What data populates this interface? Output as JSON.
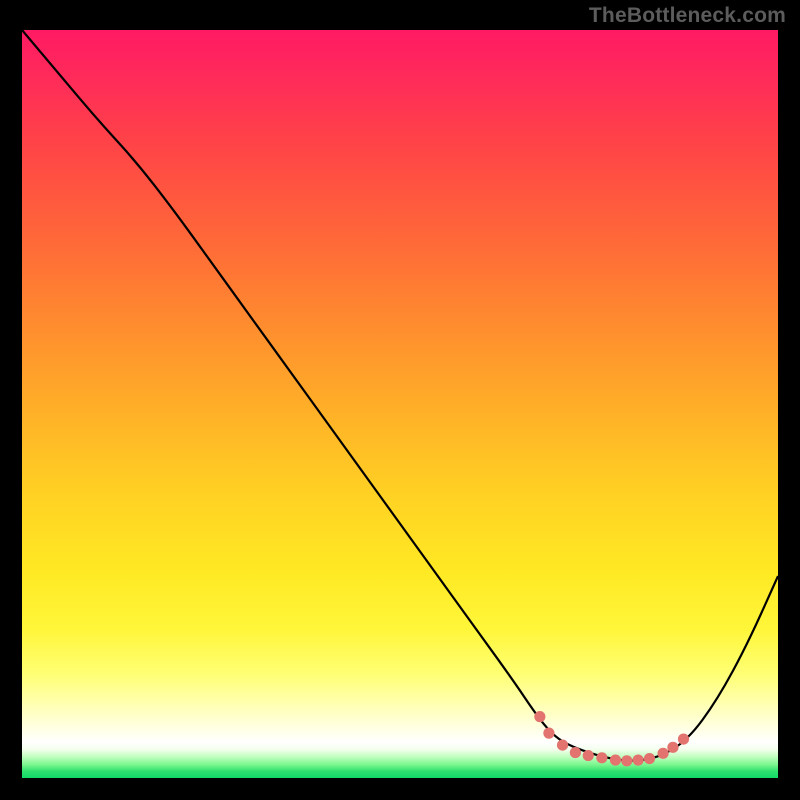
{
  "brand": {
    "watermark": "TheBottleneck.com"
  },
  "chart_data": {
    "type": "line",
    "title": "",
    "xlabel": "",
    "ylabel": "",
    "xlim": [
      0,
      100
    ],
    "ylim": [
      0,
      100
    ],
    "grid": false,
    "legend": false,
    "series": [
      {
        "name": "bottleneck-curve",
        "x": [
          0,
          5,
          10,
          15,
          20,
          25,
          30,
          35,
          40,
          45,
          50,
          55,
          60,
          65,
          68,
          70,
          72,
          76,
          80,
          84,
          88,
          92,
          96,
          100
        ],
        "values": [
          100,
          94,
          88,
          82.5,
          76,
          69,
          62,
          55,
          48,
          41,
          34,
          27,
          20,
          13,
          8.5,
          6,
          4.5,
          3.0,
          2.2,
          2.6,
          5,
          10.5,
          18,
          27
        ]
      }
    ],
    "highlight": {
      "name": "valley-dots",
      "color": "#e2736e",
      "x": [
        68.5,
        69.7,
        71.5,
        73.2,
        74.9,
        76.7,
        78.5,
        80.0,
        81.5,
        83.0,
        84.8,
        86.1,
        87.5
      ],
      "values": [
        8.2,
        6.0,
        4.4,
        3.4,
        3.0,
        2.7,
        2.4,
        2.3,
        2.4,
        2.6,
        3.3,
        4.1,
        5.2
      ]
    },
    "background": {
      "type": "vertical-gradient",
      "stops": [
        {
          "pos": 0.0,
          "color": "#ff1a63"
        },
        {
          "pos": 0.4,
          "color": "#ff8e2e"
        },
        {
          "pos": 0.72,
          "color": "#ffe823"
        },
        {
          "pos": 0.95,
          "color": "#ffffff"
        },
        {
          "pos": 1.0,
          "color": "#12d868"
        }
      ]
    }
  }
}
